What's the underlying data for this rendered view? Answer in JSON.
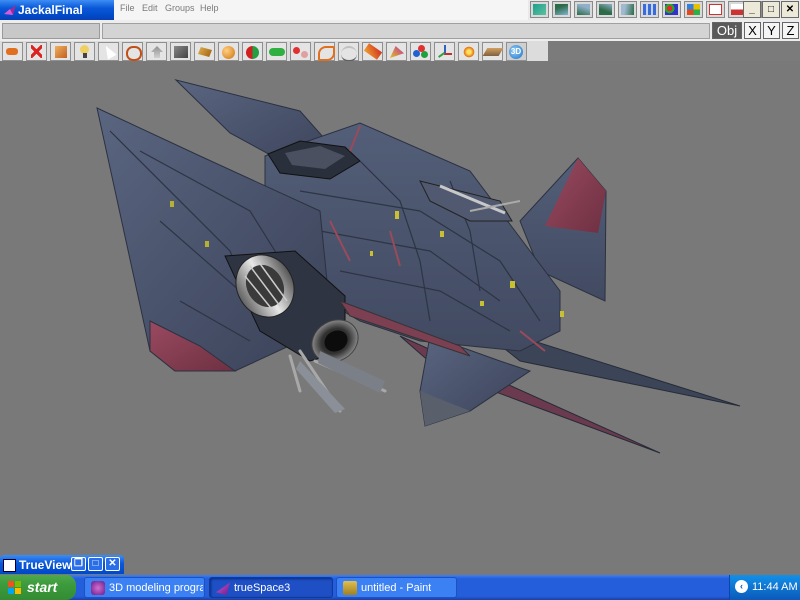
{
  "window": {
    "title": "JackalFinal"
  },
  "menu": {
    "items": [
      "File",
      "Edit",
      "Groups",
      "Help"
    ]
  },
  "top_icons": [
    "teal-icon",
    "plane-icon",
    "plane-icon",
    "plane-icon",
    "plane-icon",
    "grid-icon",
    "palette-icon",
    "colors-icon",
    "panel-icon",
    "panel-icon",
    "help-icon"
  ],
  "window_controls": {
    "minimize": "_",
    "maximize": "□",
    "close": "✕"
  },
  "axis_buttons": {
    "obj": "Obj",
    "x": "X",
    "y": "Y",
    "z": "Z"
  },
  "toolbar_icons": [
    "undo-icon",
    "delete-icon",
    "object-icon",
    "light-icon",
    "pointer-icon",
    "rotate-icon",
    "navigate-icon",
    "box-icon",
    "solid-icon",
    "sphere-icon",
    "paint-icon",
    "glue-icon",
    "unglue-icon",
    "path-icon",
    "deform-icon",
    "material-icon",
    "render-icon",
    "colors-icon",
    "axes-icon",
    "effects-icon",
    "plane-view-icon",
    "3d-icon"
  ],
  "trueview": {
    "title": "TrueView"
  },
  "taskbar": {
    "start": "start",
    "tasks": [
      {
        "label": "3D modeling program...",
        "icon": "browser-icon",
        "active": false
      },
      {
        "label": "trueSpace3",
        "icon": "truespace-icon",
        "active": true
      },
      {
        "label": "untitled - Paint",
        "icon": "paint-icon",
        "active": false
      }
    ],
    "clock": "11:44 AM"
  },
  "colors": {
    "viewport": "#797979",
    "hull": "#4a5570",
    "hull_dark": "#333a4b",
    "wing_red": "#8a3b4f",
    "xp_blue": "#245edb",
    "start_green": "#3c9a3c"
  }
}
